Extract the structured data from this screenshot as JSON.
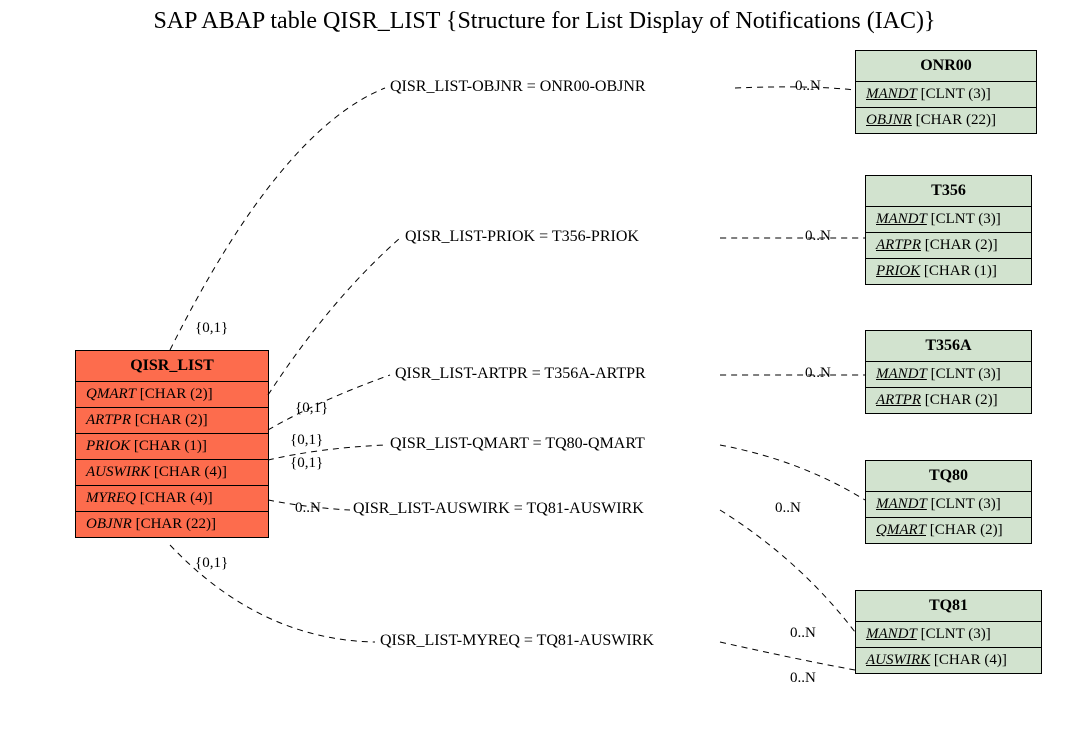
{
  "title": "SAP ABAP table QISR_LIST {Structure for List Display of Notifications (IAC)}",
  "source": {
    "name": "QISR_LIST",
    "fields": [
      {
        "fname": "QMART",
        "type": "[CHAR (2)]"
      },
      {
        "fname": "ARTPR",
        "type": "[CHAR (2)]"
      },
      {
        "fname": "PRIOK",
        "type": "[CHAR (1)]"
      },
      {
        "fname": "AUSWIRK",
        "type": "[CHAR (4)]"
      },
      {
        "fname": "MYREQ",
        "type": "[CHAR (4)]"
      },
      {
        "fname": "OBJNR",
        "type": "[CHAR (22)]"
      }
    ]
  },
  "targets": [
    {
      "name": "ONR00",
      "fields": [
        {
          "fname": "MANDT",
          "type": "[CLNT (3)]",
          "underline": true
        },
        {
          "fname": "OBJNR",
          "type": "[CHAR (22)]",
          "underline": true
        }
      ]
    },
    {
      "name": "T356",
      "fields": [
        {
          "fname": "MANDT",
          "type": "[CLNT (3)]",
          "underline": true
        },
        {
          "fname": "ARTPR",
          "type": "[CHAR (2)]",
          "underline": true
        },
        {
          "fname": "PRIOK",
          "type": "[CHAR (1)]",
          "underline": true
        }
      ]
    },
    {
      "name": "T356A",
      "fields": [
        {
          "fname": "MANDT",
          "type": "[CLNT (3)]",
          "underline": true
        },
        {
          "fname": "ARTPR",
          "type": "[CHAR (2)]",
          "underline": true
        }
      ]
    },
    {
      "name": "TQ80",
      "fields": [
        {
          "fname": "MANDT",
          "type": "[CLNT (3)]",
          "underline": true
        },
        {
          "fname": "QMART",
          "type": "[CHAR (2)]",
          "underline": true
        }
      ]
    },
    {
      "name": "TQ81",
      "fields": [
        {
          "fname": "MANDT",
          "type": "[CLNT (3)]",
          "underline": true
        },
        {
          "fname": "AUSWIRK",
          "type": "[CHAR (4)]",
          "underline": true
        }
      ]
    }
  ],
  "relations": [
    {
      "label": "QISR_LIST-OBJNR = ONR00-OBJNR",
      "src_card": "{0,1}",
      "dst_card": "0..N"
    },
    {
      "label": "QISR_LIST-PRIOK = T356-PRIOK",
      "src_card": "{0,1}",
      "dst_card": "0..N"
    },
    {
      "label": "QISR_LIST-ARTPR = T356A-ARTPR",
      "src_card": "{0,1}",
      "dst_card": "0..N"
    },
    {
      "label": "QISR_LIST-QMART = TQ80-QMART",
      "src_card": "{0,1}",
      "dst_card": "0..N"
    },
    {
      "label": "QISR_LIST-AUSWIRK = TQ81-AUSWIRK",
      "src_card": "0..N",
      "dst_card": "0..N"
    },
    {
      "label": "QISR_LIST-MYREQ = TQ81-AUSWIRK",
      "src_card": "{0,1}",
      "dst_card": "0..N"
    }
  ]
}
